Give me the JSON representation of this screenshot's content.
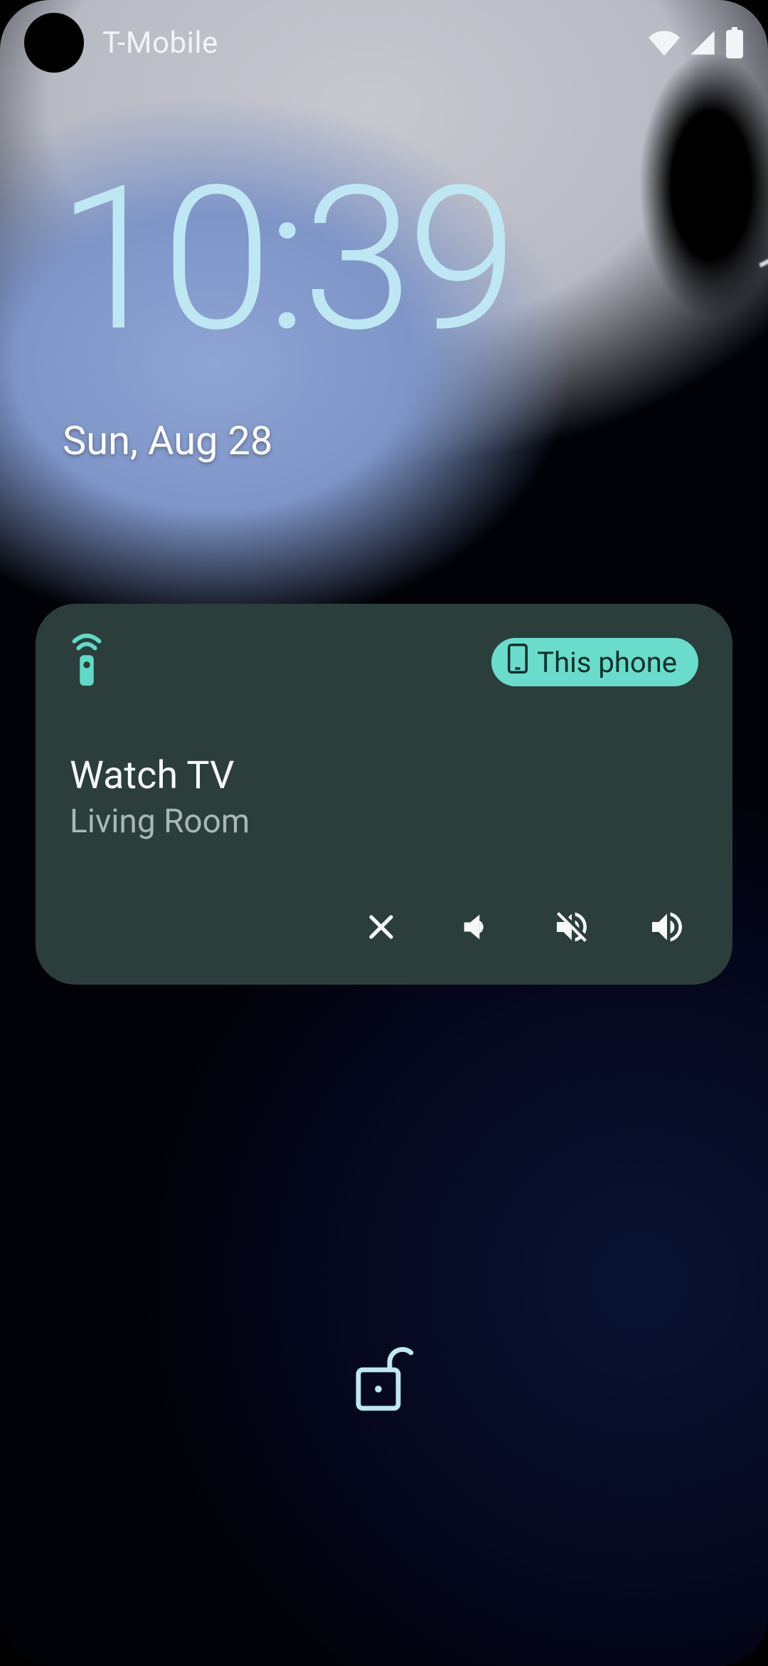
{
  "status": {
    "carrier": "T-Mobile"
  },
  "clock": {
    "time": "10:39",
    "date": "Sun, Aug 28"
  },
  "media_card": {
    "chip_label": "This phone",
    "title": "Watch TV",
    "subtitle": "Living Room"
  }
}
